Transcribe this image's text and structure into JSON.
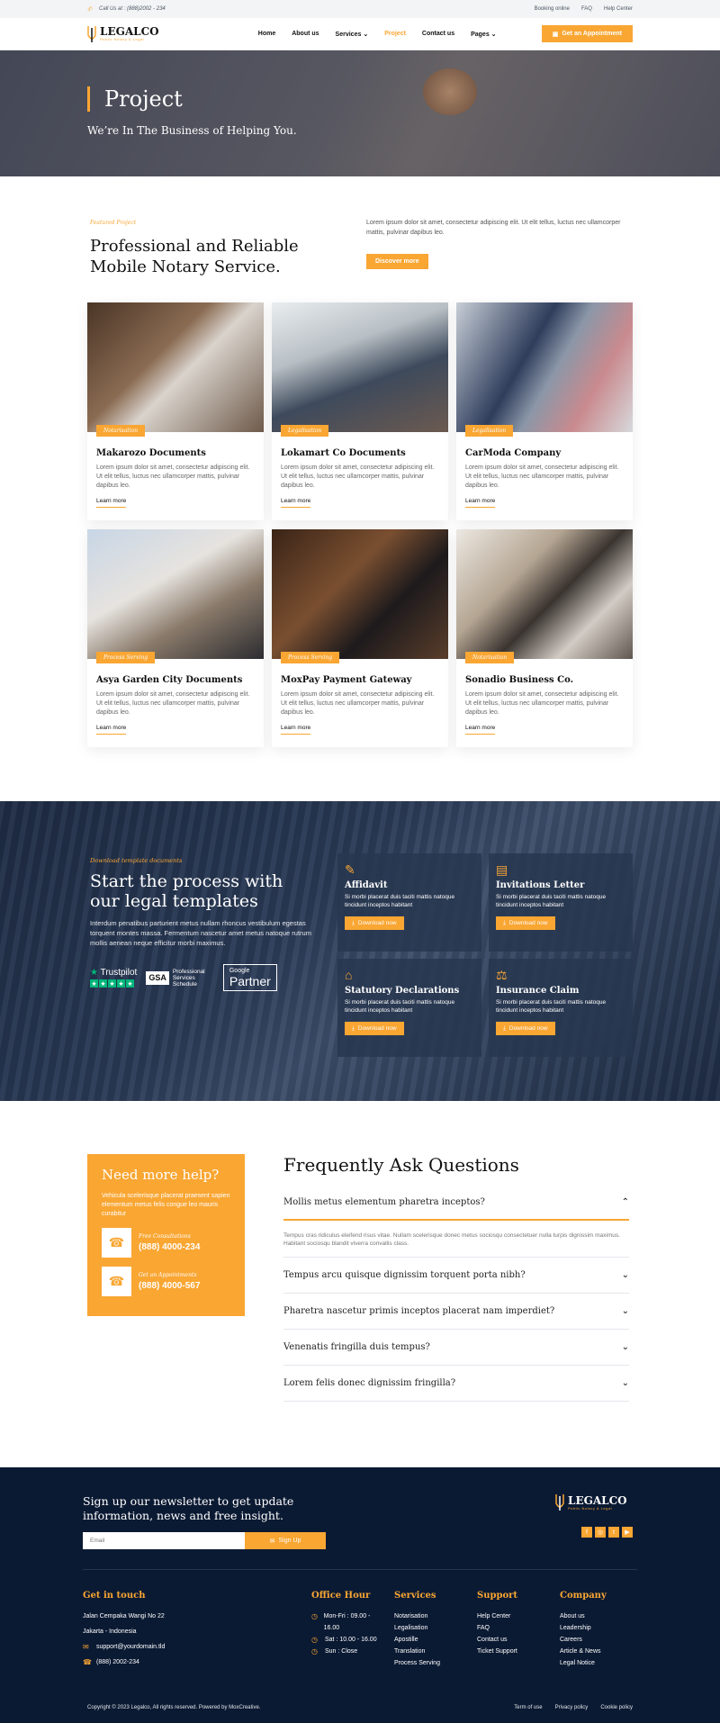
{
  "topbar": {
    "call": "Call Us at : (888)2002 - 234",
    "links": [
      "Booking online",
      "FAQ",
      "Help Center"
    ]
  },
  "brand": {
    "name": "LEGALCO",
    "tagline": "Public Notary & Legal"
  },
  "nav": {
    "items": [
      "Home",
      "About us",
      "Services",
      "Project",
      "Contact us",
      "Pages"
    ],
    "active": "Project",
    "cta": "Get an Appointment"
  },
  "hero": {
    "title": "Project",
    "subtitle": "We’re In The Business of Helping You."
  },
  "featured": {
    "kicker": "Featured Project",
    "title": "Professional and Reliable Mobile Notary Service.",
    "desc": "Lorem ipsum dolor sit amet, consectetur adipiscing elit. Ut elit tellus, luctus nec ullamcorper mattis, pulvinar dapibus leo.",
    "button": "Discover more"
  },
  "cards": [
    {
      "tag": "Notarisation",
      "title": "Makarozo Documents",
      "text": "Lorem ipsum dolor sit amet, consectetur adipiscing elit. Ut elit tellus, luctus nec ullamcorper mattis, pulvinar dapibus leo.",
      "more": "Learn more"
    },
    {
      "tag": "Legalisation",
      "title": "Lokamart Co Documents",
      "text": "Lorem ipsum dolor sit amet, consectetur adipiscing elit. Ut elit tellus, luctus nec ullamcorper mattis, pulvinar dapibus leo.",
      "more": "Learn more"
    },
    {
      "tag": "Legalisation",
      "title": "CarModa Company",
      "text": "Lorem ipsum dolor sit amet, consectetur adipiscing elit. Ut elit tellus, luctus nec ullamcorper mattis, pulvinar dapibus leo.",
      "more": "Learn more"
    },
    {
      "tag": "Process Serving",
      "title": "Asya Garden City Documents",
      "text": "Lorem ipsum dolor sit amet, consectetur adipiscing elit. Ut elit tellus, luctus nec ullamcorper mattis, pulvinar dapibus leo.",
      "more": "Learn more"
    },
    {
      "tag": "Process Serving",
      "title": "MoxPay Payment Gateway",
      "text": "Lorem ipsum dolor sit amet, consectetur adipiscing elit. Ut elit tellus, luctus nec ullamcorper mattis, pulvinar dapibus leo.",
      "more": "Learn more"
    },
    {
      "tag": "Notarisation",
      "title": "Sonadio Business Co.",
      "text": "Lorem ipsum dolor sit amet, consectetur adipiscing elit. Ut elit tellus, luctus nec ullamcorper mattis, pulvinar dapibus leo.",
      "more": "Learn more"
    }
  ],
  "templates": {
    "kicker": "Download template documents",
    "title": "Start the process with our legal templates",
    "desc": "Interdum penatibus parturient metus nullam rhoncus vestibulum egestas torquent montes massa. Fermentum nascetur amet metus natoque rutrum mollis aenean neque efficitur morbi maximus.",
    "trustpilot": "Trustpilot",
    "gsa": "GSA",
    "gsa_text": "Professional Services Schedule",
    "google": "Google",
    "partner": "Partner",
    "items": [
      {
        "title": "Affidavit",
        "desc": "Si morbi placerat duis taciti mattis natoque tincidunt inceptos habitant",
        "button": "Download now"
      },
      {
        "title": "Invitations Letter",
        "desc": "Si morbi placerat duis taciti mattis natoque tincidunt inceptos habitant",
        "button": "Download now"
      },
      {
        "title": "Statutory Declarations",
        "desc": "Si morbi placerat duis taciti mattis natoque tincidunt inceptos habitant",
        "button": "Download now"
      },
      {
        "title": "Insurance Claim",
        "desc": "Si morbi placerat duis taciti mattis natoque tincidunt inceptos habitant",
        "button": "Download now"
      }
    ]
  },
  "help": {
    "title": "Need more help?",
    "desc": "Vehicula scelerisque placerat praesent sapien elementum metus felis congue leo mauris curabitur",
    "free_label": "Free Consultations",
    "free_phone": "(888) 4000-234",
    "appt_label": "Get an Appointments",
    "appt_phone": "(888) 4000-567"
  },
  "faq": {
    "title": "Frequently Ask Questions",
    "open_q": "Mollis metus elementum pharetra inceptos?",
    "open_a": "Tempus cras ridiculus eleifend risus vitae. Nullam scelerisque donec metus sociosqu consectetuer nulla turpis dignissim maximus. Habitant sociosqu blandit viverra convallis class.",
    "questions": [
      "Tempus arcu quisque dignissim torquent porta nibh?",
      "Pharetra nascetur primis inceptos placerat nam imperdiet?",
      "Venenatis fringilla duis tempus?",
      "Lorem felis donec dignissim fringilla?"
    ]
  },
  "footer": {
    "newsletter": "Sign up our newsletter to get update information, news and free insight.",
    "email_placeholder": "Email",
    "signup": "Sign Up",
    "get_in_touch": "Get in touch",
    "address1": "Jalan Cempaka Wangi No 22",
    "address2": "Jakarta - Indonesia",
    "email": "support@yourdomain.tld",
    "phone": "(888) 2002-234",
    "office_title": "Office Hour",
    "office": [
      "Mon-Fri : 09.00 - 16.00",
      "Sat : 10.00 - 16.00",
      "Sun : Close"
    ],
    "services_title": "Services",
    "services": [
      "Notarisation",
      "Legalisation",
      "Apostille",
      "Translation",
      "Process Serving"
    ],
    "support_title": "Support",
    "support": [
      "Help Center",
      "FAQ",
      "Contact us",
      "Ticket Support"
    ],
    "company_title": "Company",
    "company": [
      "About us",
      "Leadership",
      "Careers",
      "Article & News",
      "Legal Notice"
    ],
    "copyright": "Copyright © 2023 Legalco, All rights reserved. Powered by MoxCreative.",
    "bottom_links": [
      "Term of use",
      "Privacy policy",
      "Cookie policy"
    ]
  },
  "colors": {
    "accent": "#f9a633",
    "dark": "#0b1a33",
    "navy": "#1d2b44"
  }
}
